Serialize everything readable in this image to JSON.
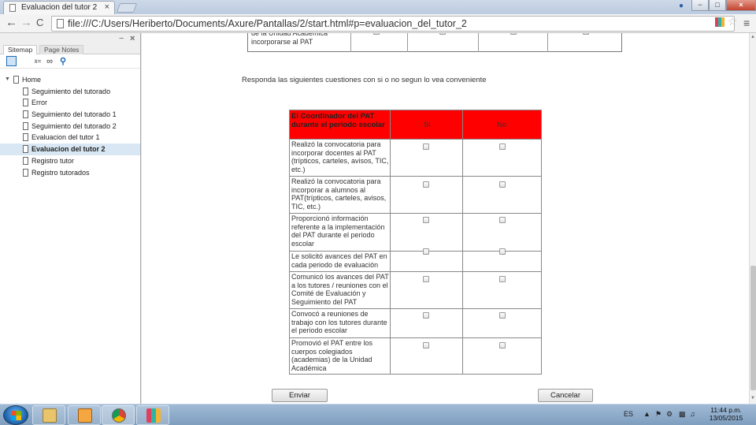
{
  "browser": {
    "tab_title": "Evaluacion del tutor 2",
    "tab_close": "×",
    "url": "file:///C:/Users/Heriberto/Documents/Axure/Pantallas/2/start.html#p=evaluacion_del_tutor_2",
    "back": "←",
    "forward": "→",
    "reload": "C",
    "star": "☆",
    "menu": "≡",
    "minimize": "−",
    "maximize": "□",
    "close": "×"
  },
  "sidebar": {
    "tabs": [
      "Sitemap",
      "Page Notes"
    ],
    "minimize": "−",
    "close": "×",
    "tools": [
      "",
      "",
      "x=",
      "∞",
      "⚲"
    ],
    "home": "Home",
    "pages": [
      "Seguimiento del tutorado",
      "Error",
      "Seguimiento del tutorado 1",
      "Seguimiento del tutorado 2",
      "Evaluacion del tutor 1",
      "Evaluacion del tutor 2",
      "Registro tutor",
      "Registro tutorados"
    ],
    "selected_index": 5
  },
  "main": {
    "top_row_text": "de la Unidad Académica incorporarse al PAT",
    "instructions": "Responda las siguientes cuestiones con si o no segun lo vea conveniente",
    "table": {
      "header_label": "El Coordinador del PAT durante el periodo escolar",
      "col_si": "Si",
      "col_no": "No",
      "header_color": "#ff0000",
      "rows": [
        "Realizó la convocatoria para incorporar docentes al PAT (trípticos, carteles, avisos, TIC, etc.)",
        "Realizó la convocatoria para incorporar a alumnos al PAT(trípticos, carteles, avisos, TIC, etc.)",
        "Proporcionó información referente a la implementación del PAT durante el periodo escolar",
        "Le solicitó avances del PAT en cada periodo de evaluación",
        "Comunicó los avances del PAT a los tutores / reuniones con el Comité de Evaluación y Seguimiento del PAT",
        "Convocó a reuniones de trabajo con los tutores durante el periodo escolar",
        "Promovió el PAT entre los cuerpos colegiados (academias) de la Unidad Académica"
      ]
    },
    "submit_label": "Enviar",
    "cancel_label": "Cancelar"
  },
  "taskbar": {
    "language": "ES",
    "time": "11:44 p.m.",
    "date": "13/05/2015"
  }
}
